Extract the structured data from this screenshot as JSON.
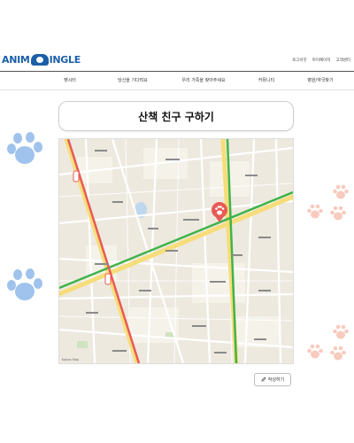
{
  "header": {
    "logo_left": "ANIM",
    "logo_right": "INGLE",
    "utility_links": [
      "로그아웃",
      "마이페이지",
      "고객센터"
    ]
  },
  "nav": {
    "items": [
      "펫시터",
      "당신을 기다려요",
      "우리 가족을 찾아주세요",
      "커뮤니티",
      "병원/약국찾기"
    ]
  },
  "page": {
    "title": "산책 친구 구하기",
    "write_button": "작성하기"
  },
  "map": {
    "copyright": "Kakao Map",
    "marker": "paw-marker"
  },
  "colors": {
    "brand_blue": "#1b5fa8",
    "paw_blue": "#9fc3ec",
    "paw_pink": "#f7cbbd",
    "marker_red": "#e85a55",
    "subway_green": "#40b34a"
  }
}
